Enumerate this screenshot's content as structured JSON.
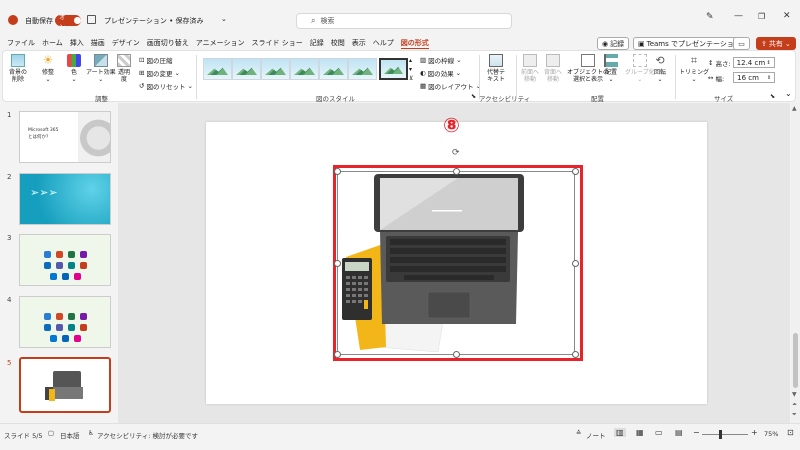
{
  "titlebar": {
    "autosave_label": "自動保存",
    "autosave_state": "オン",
    "doc_title": "プレゼンテーション • 保存済み",
    "search_placeholder": "検索"
  },
  "menu": {
    "tabs": [
      "ファイル",
      "ホーム",
      "挿入",
      "描画",
      "デザイン",
      "画面切り替え",
      "アニメーション",
      "スライド ショー",
      "記録",
      "校閲",
      "表示",
      "ヘルプ",
      "図の形式"
    ],
    "active_tab": "図の形式",
    "record_btn": "記録",
    "teams_btn": "Teams でプレゼンテーション",
    "share_btn": "共有"
  },
  "ribbon": {
    "adjust": {
      "remove_bg": [
        "背景の",
        "削除"
      ],
      "corrections": "修整",
      "color": "色",
      "artistic": "アート効果",
      "transparency": [
        "透明",
        "度"
      ],
      "compress": "図の圧縮",
      "change": "図の変更",
      "reset": "図のリセット",
      "group_label": "調整"
    },
    "styles": {
      "border": "図の枠線",
      "effects": "図の効果",
      "layout": "図のレイアウト",
      "group_label": "図のスタイル"
    },
    "accessibility": {
      "alt_text": [
        "代替テ",
        "キスト"
      ],
      "group_label": "アクセシビリティ"
    },
    "arrange": {
      "forward": [
        "前面へ",
        "移動"
      ],
      "backward": [
        "背面へ",
        "移動"
      ],
      "selection_pane": [
        "オブジェクトの",
        "選択と表示"
      ],
      "align": "配置",
      "group": [
        "グループ化"
      ],
      "rotate": "回転",
      "group_label": "配置"
    },
    "size": {
      "crop": "トリミング",
      "height_label": "高さ:",
      "height_value": "12.4 cm",
      "width_label": "幅:",
      "width_value": "16 cm",
      "group_label": "サイズ"
    }
  },
  "slides": {
    "numbers": [
      "1",
      "2",
      "3",
      "4",
      "5"
    ],
    "active": "5",
    "slide1_title": [
      "Microsoft 365",
      "とは何か？"
    ]
  },
  "annotation": {
    "marker": "⑧",
    "color": "#e8232a"
  },
  "statusbar": {
    "slide_pos": "スライド 5/5",
    "language": "日本語",
    "accessibility": "アクセシビリティ: 検討が必要です",
    "notes": "ノート",
    "zoom": "75%"
  },
  "colors": {
    "accent": "#c43e1c",
    "highlight": "#e8232a"
  }
}
